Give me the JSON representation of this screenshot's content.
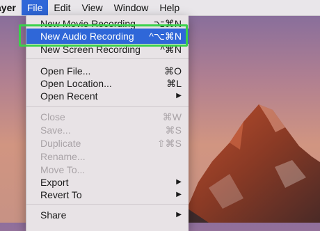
{
  "menubar": {
    "app": "ayer",
    "items": [
      "File",
      "Edit",
      "View",
      "Window",
      "Help"
    ],
    "active": "File"
  },
  "menu": {
    "items": [
      {
        "label": "New Movie Recording",
        "shortcut": "⌥⌘N",
        "state": "enabled"
      },
      {
        "label": "New Audio Recording",
        "shortcut": "^⌥⌘N",
        "state": "highlighted"
      },
      {
        "label": "New Screen Recording",
        "shortcut": "^⌘N",
        "state": "enabled"
      },
      {
        "label": "Open File...",
        "shortcut": "⌘O",
        "state": "enabled"
      },
      {
        "label": "Open Location...",
        "shortcut": "⌘L",
        "state": "enabled"
      },
      {
        "label": "Open Recent",
        "shortcut": "▶",
        "state": "enabled"
      },
      {
        "label": "Close",
        "shortcut": "⌘W",
        "state": "disabled"
      },
      {
        "label": "Save...",
        "shortcut": "⌘S",
        "state": "disabled"
      },
      {
        "label": "Duplicate",
        "shortcut": "⇧⌘S",
        "state": "disabled"
      },
      {
        "label": "Rename...",
        "shortcut": "",
        "state": "disabled"
      },
      {
        "label": "Move To...",
        "shortcut": "",
        "state": "disabled"
      },
      {
        "label": "Export",
        "shortcut": "▶",
        "state": "enabled"
      },
      {
        "label": "Revert To",
        "shortcut": "▶",
        "state": "enabled"
      },
      {
        "label": "Share",
        "shortcut": "▶",
        "state": "enabled"
      }
    ]
  },
  "colors": {
    "highlight": "#2f67d8",
    "annotation": "#39d24a"
  }
}
